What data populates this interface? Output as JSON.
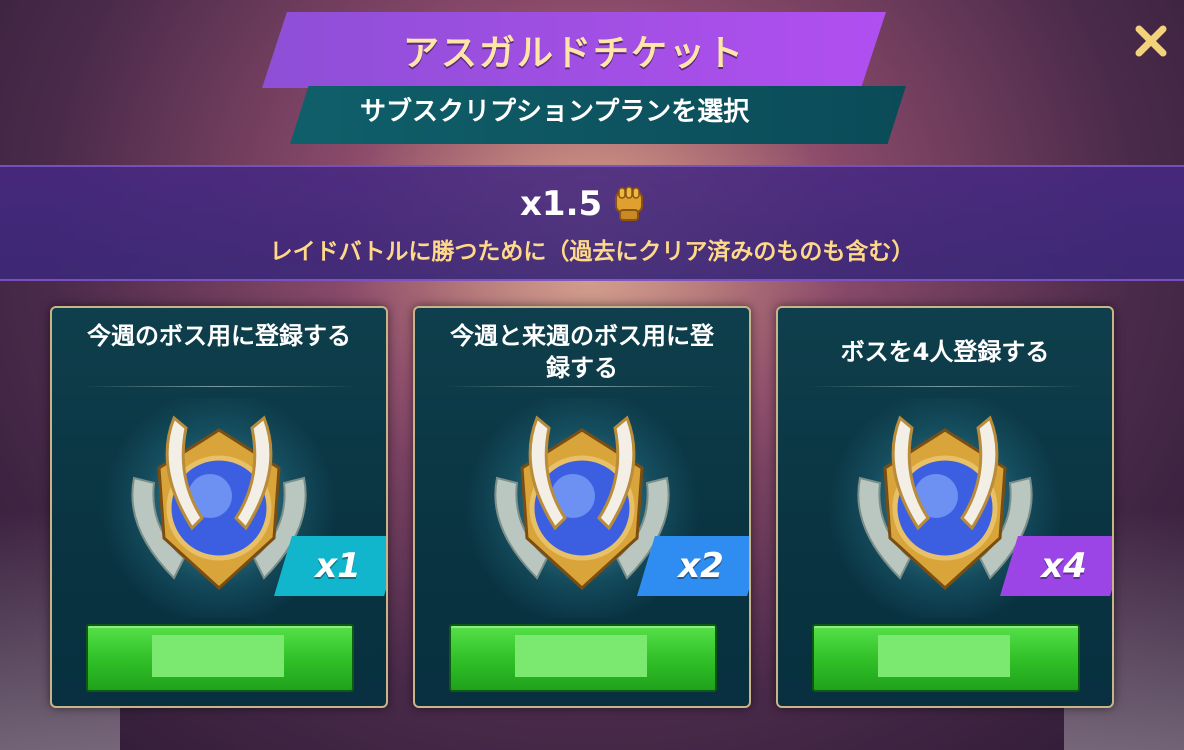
{
  "header": {
    "title": "アスガルドチケット",
    "subtitle": "サブスクリプションプランを選択"
  },
  "info": {
    "multiplier": "x1.5",
    "multiplier_icon": "fist-icon",
    "description": "レイドバトルに勝つために（過去にクリア済みのものも含む）"
  },
  "plans": [
    {
      "title": "今週のボス用に登録する",
      "count": "x1",
      "badge_color": "#11b6cc",
      "button_label": ""
    },
    {
      "title": "今週と来週のボス用に登録する",
      "count": "x2",
      "badge_color": "#2f8cf0",
      "button_label": ""
    },
    {
      "title": "ボスを4人登録する",
      "count": "x4",
      "badge_color": "#9b45e6",
      "button_label": ""
    }
  ],
  "colors": {
    "title_banner": "#a94fe8",
    "subtitle_banner": "#0d5563",
    "accent_gold": "#ffd98a",
    "button_green": "#2fbf27"
  }
}
